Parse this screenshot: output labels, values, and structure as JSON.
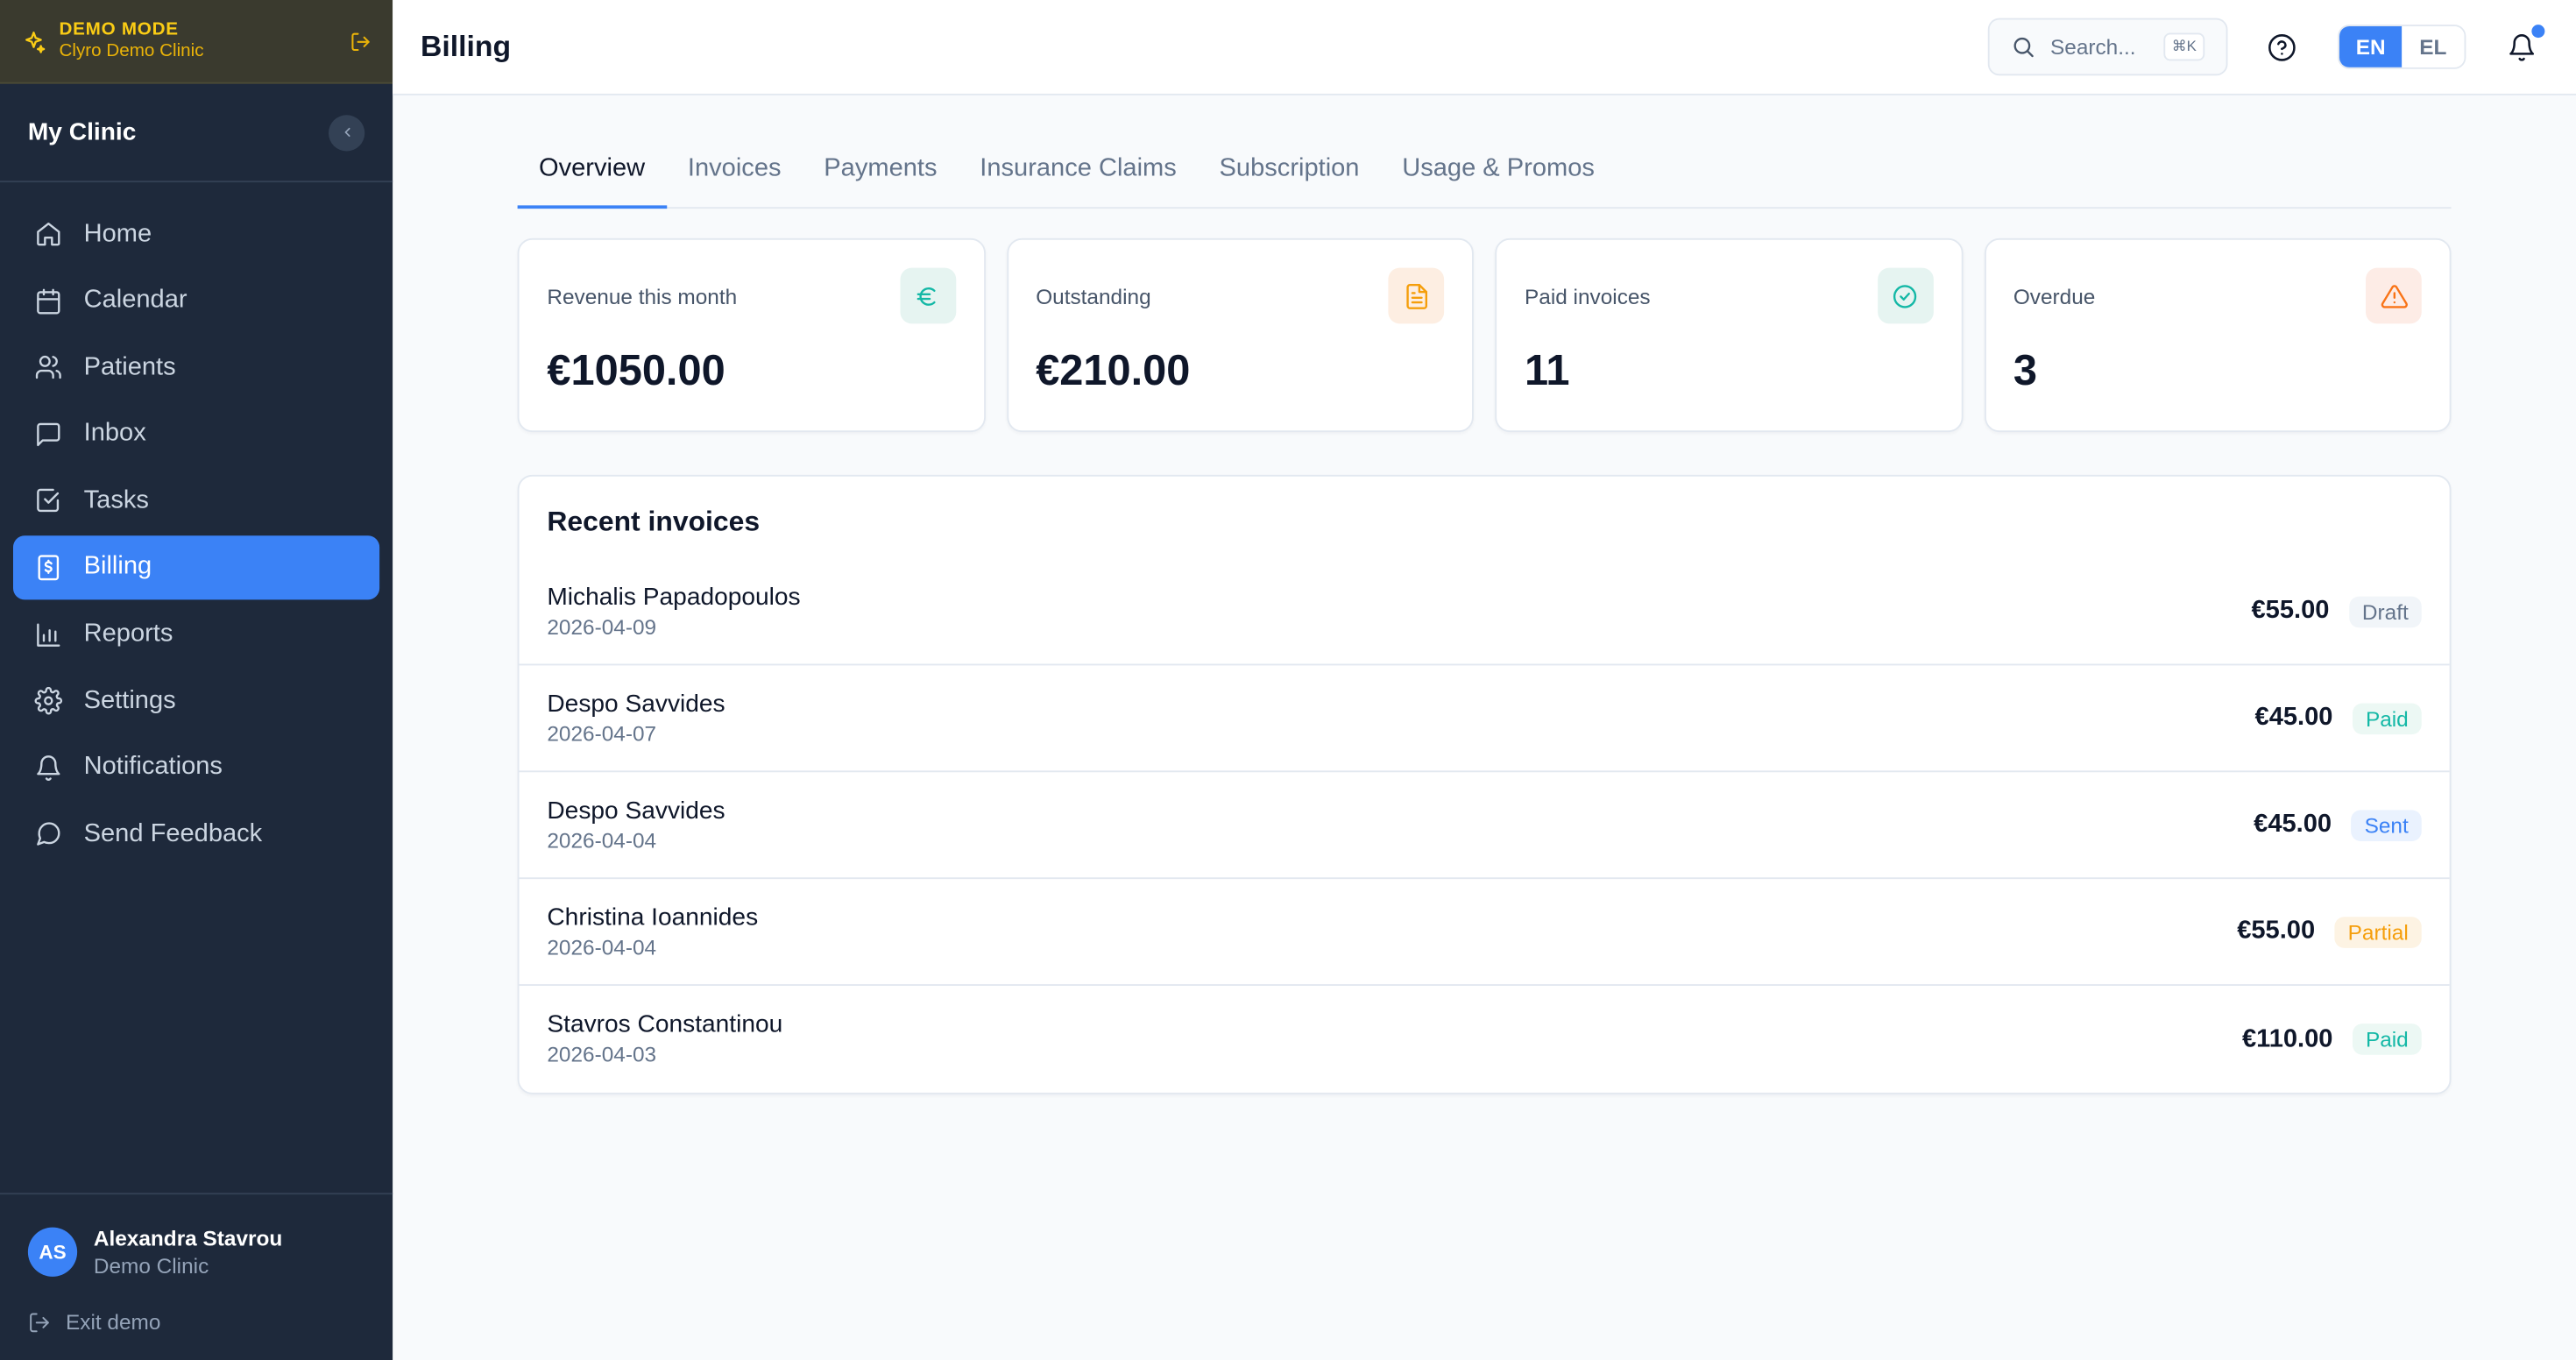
{
  "demo": {
    "title": "DEMO MODE",
    "subtitle": "Clyro Demo Clinic"
  },
  "sidebar": {
    "clinic_name": "My Clinic",
    "items": [
      {
        "label": "Home",
        "icon": "home-icon"
      },
      {
        "label": "Calendar",
        "icon": "calendar-icon"
      },
      {
        "label": "Patients",
        "icon": "users-icon"
      },
      {
        "label": "Inbox",
        "icon": "message-icon"
      },
      {
        "label": "Tasks",
        "icon": "check-square-icon"
      },
      {
        "label": "Billing",
        "icon": "receipt-icon",
        "active": true
      },
      {
        "label": "Reports",
        "icon": "bar-chart-icon"
      },
      {
        "label": "Settings",
        "icon": "gear-icon"
      },
      {
        "label": "Notifications",
        "icon": "bell-icon"
      },
      {
        "label": "Send Feedback",
        "icon": "chat-bubble-icon"
      }
    ],
    "user": {
      "initials": "AS",
      "name": "Alexandra Stavrou",
      "clinic": "Demo Clinic"
    },
    "exit_label": "Exit demo"
  },
  "header": {
    "title": "Billing",
    "search_placeholder": "Search...",
    "search_shortcut": "⌘K",
    "languages": [
      "EN",
      "EL"
    ],
    "active_language": "EN"
  },
  "tabs": [
    "Overview",
    "Invoices",
    "Payments",
    "Insurance Claims",
    "Subscription",
    "Usage & Promos"
  ],
  "active_tab": "Overview",
  "stats": [
    {
      "label": "Revenue this month",
      "value": "€1050.00",
      "icon": "euro-icon"
    },
    {
      "label": "Outstanding",
      "value": "€210.00",
      "icon": "document-icon"
    },
    {
      "label": "Paid invoices",
      "value": "11",
      "icon": "check-circle-icon"
    },
    {
      "label": "Overdue",
      "value": "3",
      "icon": "warning-icon"
    }
  ],
  "recent": {
    "title": "Recent invoices",
    "rows": [
      {
        "name": "Michalis Papadopoulos",
        "date": "2026-04-09",
        "amount": "€55.00",
        "status": "Draft"
      },
      {
        "name": "Despo Savvides",
        "date": "2026-04-07",
        "amount": "€45.00",
        "status": "Paid"
      },
      {
        "name": "Despo Savvides",
        "date": "2026-04-04",
        "amount": "€45.00",
        "status": "Sent"
      },
      {
        "name": "Christina Ioannides",
        "date": "2026-04-04",
        "amount": "€55.00",
        "status": "Partial"
      },
      {
        "name": "Stavros Constantinou",
        "date": "2026-04-03",
        "amount": "€110.00",
        "status": "Paid"
      }
    ]
  },
  "colors": {
    "accent": "#3b82f6",
    "sidebar_bg": "#1e293b",
    "demo_yellow": "#facc15"
  }
}
